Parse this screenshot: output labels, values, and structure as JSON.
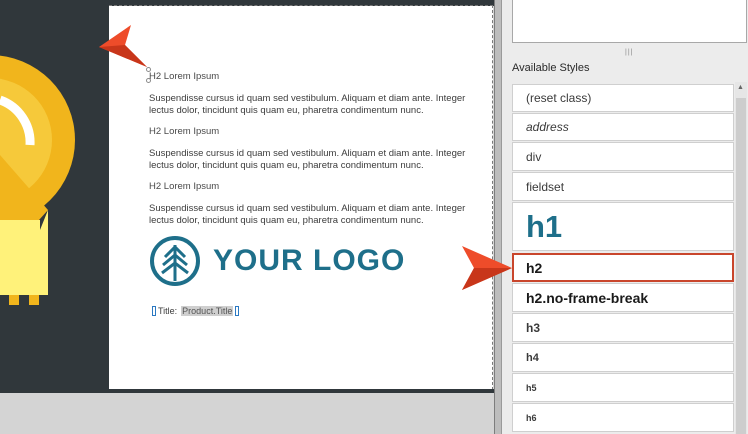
{
  "document": {
    "heading_1": "H2 Lorem Ipsum",
    "paragraph_1": "Suspendisse cursus id quam sed vestibulum. Aliquam et diam ante. Integer lectus dolor, tincidunt quis quam eu, pharetra condimentum nunc.",
    "heading_2": "H2 Lorem Ipsum",
    "paragraph_2": "Suspendisse cursus id quam sed vestibulum. Aliquam et diam ante. Integer lectus dolor, tincidunt quis quam eu, pharetra condimentum nunc.",
    "heading_3": "H2 Lorem Ipsum",
    "paragraph_3": "Suspendisse cursus id quam sed vestibulum. Aliquam et diam ante. Integer lectus dolor, tincidunt quis quam eu, pharetra condimentum nunc.",
    "logo_text": "YOUR LOGO",
    "title_label": "Title:",
    "title_variable": "Product.Title"
  },
  "styles_panel": {
    "label": "Available Styles",
    "grip": "|||",
    "items": [
      {
        "label": "(reset class)"
      },
      {
        "label": "address"
      },
      {
        "label": "div"
      },
      {
        "label": "fieldset"
      },
      {
        "label": "h1"
      },
      {
        "label": "h2"
      },
      {
        "label": "h2.no-frame-break"
      },
      {
        "label": "h3"
      },
      {
        "label": "h4"
      },
      {
        "label": "h5"
      },
      {
        "label": "h6"
      }
    ],
    "selected_item": "h2"
  },
  "colors": {
    "dark_panel": "#30373b",
    "logo": "#1e6f8a",
    "h1_style": "#1e6f8a",
    "arrow": "#ee4c2a",
    "selection_border": "#c9462c",
    "illustration_yellow": "#f1b51c",
    "illustration_light_yellow": "#fff27a"
  },
  "icons": {
    "pointer_arrow": "callout-arrow-icon",
    "logo_symbol": "pine-tree-icon",
    "scroll_up": "chevron-up-icon"
  }
}
